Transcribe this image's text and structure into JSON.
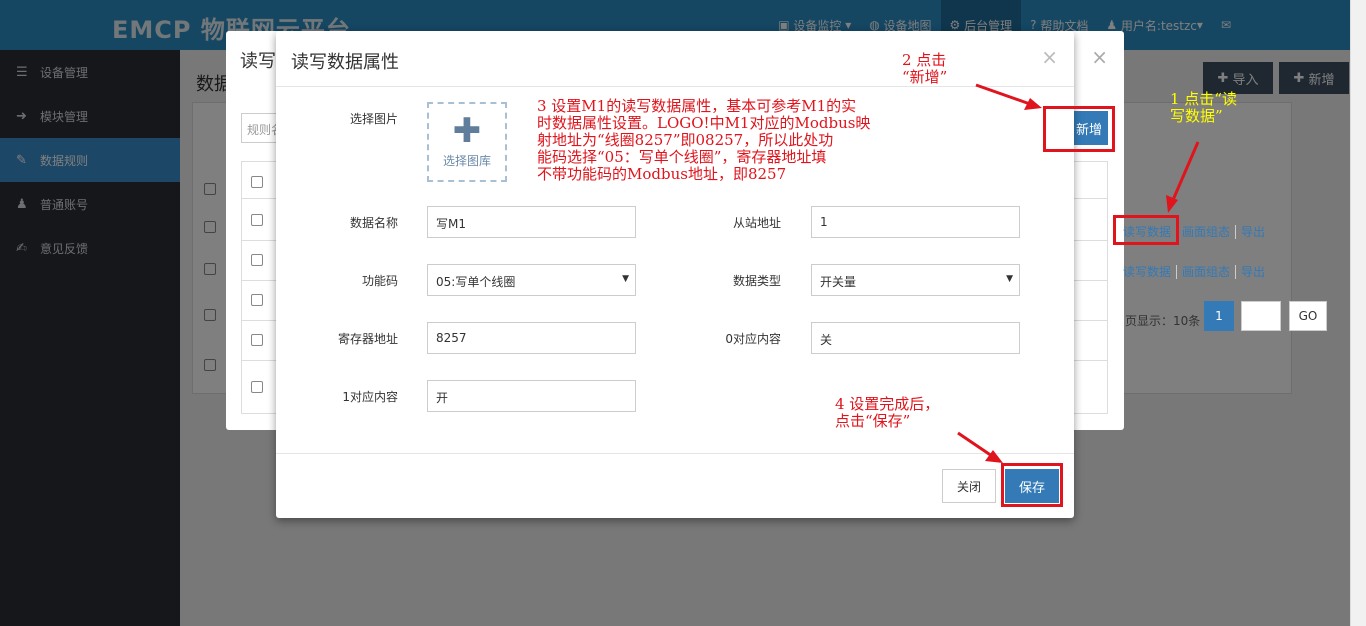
{
  "app": {
    "logo": "EMCP 物联网云平台",
    "nav": [
      "设备监控",
      "设备地图",
      "后台管理",
      "帮助文档",
      "用户名:testzc"
    ]
  },
  "sidebar": {
    "items": [
      {
        "icon": "list-icon",
        "label": "设备管理"
      },
      {
        "icon": "login-icon",
        "label": "模块管理"
      },
      {
        "icon": "pencil-icon",
        "label": "数据规则"
      },
      {
        "icon": "user-icon",
        "label": "普通账号"
      },
      {
        "icon": "edit-icon",
        "label": "意见反馈"
      }
    ]
  },
  "page": {
    "title": "数据",
    "import_label": "导入",
    "add_label": "新增"
  },
  "bg_modal": {
    "title": "读写",
    "search_placeholder": "规则名",
    "new_label": "新增",
    "row_links": [
      "读写数据",
      "画面组态",
      "导出"
    ],
    "pager_text": "页显示：10条",
    "page_current": "1",
    "go_label": "GO"
  },
  "modal": {
    "title": "读写数据属性",
    "image_label": "选择图片",
    "image_picker_text": "选择图库",
    "fields": {
      "data_name": {
        "label": "数据名称",
        "value": "写M1"
      },
      "slave_address": {
        "label": "从站地址",
        "value": "1"
      },
      "function_code": {
        "label": "功能码",
        "value": "05:写单个线圈"
      },
      "data_type": {
        "label": "数据类型",
        "value": "开关量"
      },
      "register_address": {
        "label": "寄存器地址",
        "value": "8257"
      },
      "zero_content": {
        "label": "0对应内容",
        "value": "关"
      },
      "one_content": {
        "label": "1对应内容",
        "value": "开"
      }
    },
    "close_label": "关闭",
    "save_label": "保存"
  },
  "annotations": {
    "step1": "1 点击“读\n写数据”",
    "step2": "2 点击\n“新增”",
    "step3": "3 设置M1的读写数据属性，基本可参考M1的实\n时数据属性设置。LOGO!中M1对应的Modbus映\n射地址为“线圈8257”即08257，所以此处功\n能码选择“05：写单个线圈”，寄存器地址填\n不带功能码的Modbus地址，即8257",
    "step4": "4 设置完成后，\n点击“保存”",
    "red_color": "#e0141c",
    "yellow_color": "#ffff00"
  }
}
